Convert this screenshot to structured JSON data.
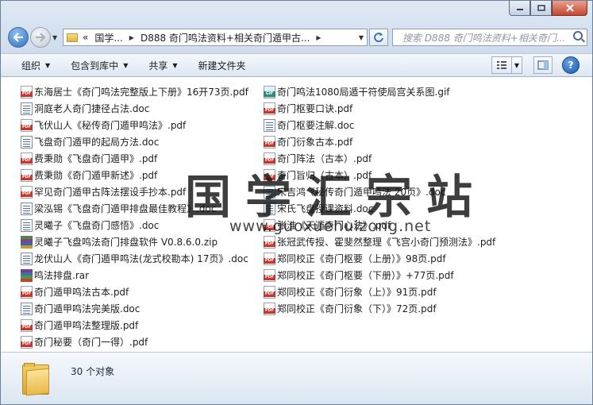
{
  "address": {
    "segments": [
      "«",
      "国学...",
      "D888 奇门鸣法资料+相关奇门遁甲古..."
    ],
    "search_placeholder": "搜索 D888 奇门鸣法资料+相关奇门..."
  },
  "toolbar": {
    "organize": "组织",
    "include_in_library": "包含到库中",
    "share": "共享",
    "new_folder": "新建文件夹",
    "help": "?"
  },
  "files_left": [
    {
      "name": "东海居士《奇门鸣法完整版上下册》16开73页.pdf",
      "type": "pdf"
    },
    {
      "name": "洞庭老人奇门捷径占法.doc",
      "type": "doc"
    },
    {
      "name": "飞伏山人《秘传奇门遁甲鸣法》.pdf",
      "type": "pdf"
    },
    {
      "name": "飞盘奇门遁甲的起局方法.doc",
      "type": "doc"
    },
    {
      "name": "费秉勋《飞盘奇门遁甲》.pdf",
      "type": "pdf"
    },
    {
      "name": "费秉勋《奇门遁甲新述》.pdf",
      "type": "pdf"
    },
    {
      "name": "罕见奇门遁甲古阵法摆设手抄本.pdf",
      "type": "pdf"
    },
    {
      "name": "梁泓锡《飞盘奇门遁甲排盘最佳教程》.doc",
      "type": "doc"
    },
    {
      "name": "灵曦子《飞盘奇门感悟》.doc",
      "type": "doc"
    },
    {
      "name": "灵曦子飞盘鸣法奇门排盘软件 V0.8.6.0.zip",
      "type": "zip"
    },
    {
      "name": "龙伏山人《奇门遁甲鸣法(龙式校勘本) 17页》.doc",
      "type": "doc"
    },
    {
      "name": "鸣法排盘.rar",
      "type": "rar"
    },
    {
      "name": "奇门遁甲鸣法古本.pdf",
      "type": "pdf"
    },
    {
      "name": "奇门遁甲鸣法完美版.doc",
      "type": "doc"
    },
    {
      "name": "奇门遁甲鸣法整理版.pdf",
      "type": "pdf"
    },
    {
      "name": "奇门秘要（奇门一得）.pdf",
      "type": "pdf"
    }
  ],
  "files_right": [
    {
      "name": "奇门鸣法1080局遁干符使局宫关系图.gif",
      "type": "gif"
    },
    {
      "name": "奇门枢要口诀.pdf",
      "type": "pdf"
    },
    {
      "name": "奇门枢要注解.doc",
      "type": "doc"
    },
    {
      "name": "奇门衍象古本.pdf",
      "type": "pdf"
    },
    {
      "name": "奇门阵法（古本）.pdf",
      "type": "pdf"
    },
    {
      "name": "奇门旨归（古本）.pdf",
      "type": "pdf"
    },
    {
      "name": "宋吉鸿《秘传奇门遁甲鸣法 20页》.doc",
      "type": "doc"
    },
    {
      "name": "宋氏飞盘授课资料.doc",
      "type": "doc"
    },
    {
      "name": "张淮《天遁奇门心法》.pdf",
      "type": "pdf"
    },
    {
      "name": "张冠武传授、霍斐然整理《飞宫小奇门预测法》.pdf",
      "type": "pdf"
    },
    {
      "name": "郑同校正《奇门枢要（上册）》98页.pdf",
      "type": "pdf"
    },
    {
      "name": "郑同校正《奇门枢要（下册）》+77页.pdf",
      "type": "pdf"
    },
    {
      "name": "郑同校正《奇门衍象（上）》91页.pdf",
      "type": "pdf"
    },
    {
      "name": "郑同校正《奇门衍象（下）》72页.pdf",
      "type": "pdf"
    }
  ],
  "watermark": {
    "title": "国学汇宗站",
    "url": "www.guoxuehuizong.net"
  },
  "status": {
    "count_text": "30 个对象"
  },
  "colors": {
    "pdf_badge": "#c8352b",
    "chrome_bg": "#dfe9f5",
    "close_button": "#c6482f"
  }
}
